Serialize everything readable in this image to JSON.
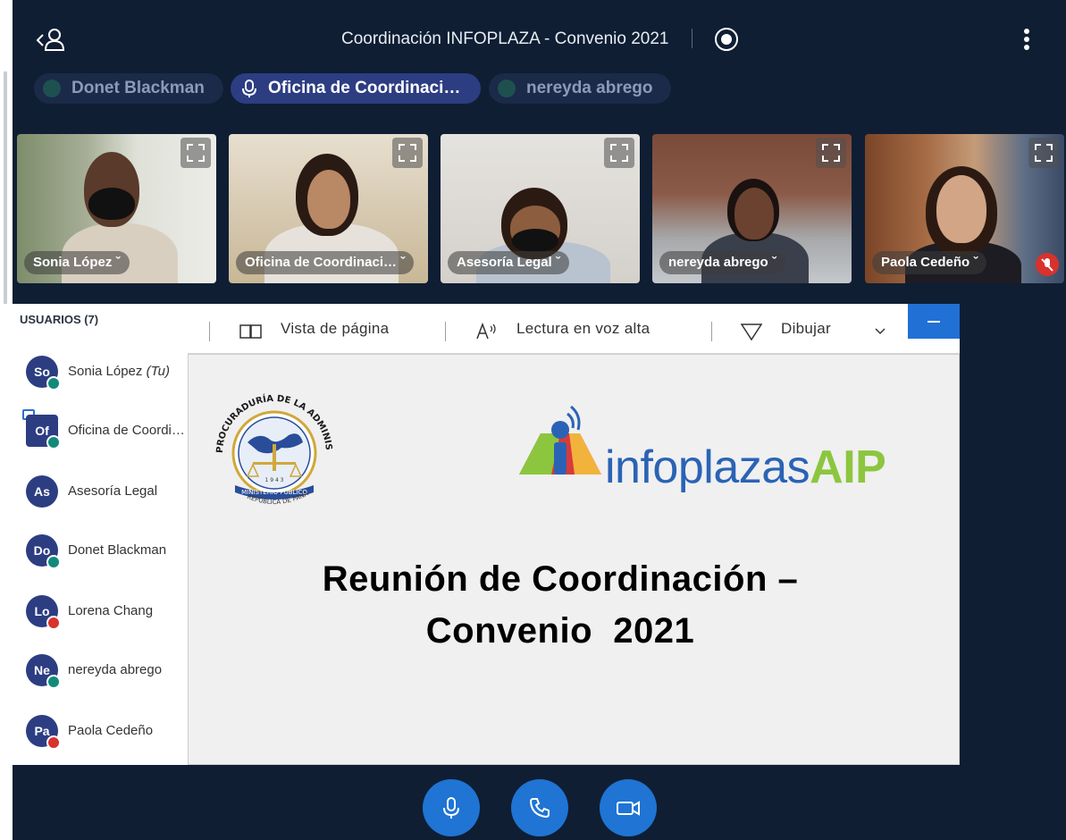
{
  "header": {
    "meeting_title": "Coordinación INFOPLAZA - Convenio 2021"
  },
  "speakers": [
    {
      "label": "Donet Blackman",
      "active": false
    },
    {
      "label": "Oficina de Coordinaci…",
      "active": true
    },
    {
      "label": "nereyda abrego",
      "active": false
    }
  ],
  "tiles": [
    {
      "label": "Sonia López ˇ"
    },
    {
      "label": "Oficina de Coordinaci… ˇ"
    },
    {
      "label": "Asesoría Legal ˇ"
    },
    {
      "label": "nereyda abrego ˇ"
    },
    {
      "label": "Paola Cedeño ˇ"
    }
  ],
  "users_panel": {
    "title": "USUARIOS (7)",
    "users": [
      {
        "initials": "So",
        "name": "Sonia López",
        "suffix": "(Tu)",
        "mic": "on"
      },
      {
        "initials": "Of",
        "name": "Oficina de Coordina…",
        "suffix": "",
        "mic": "on"
      },
      {
        "initials": "As",
        "name": "Asesoría Legal",
        "suffix": "",
        "mic": "off-none"
      },
      {
        "initials": "Do",
        "name": "Donet Blackman",
        "suffix": "",
        "mic": "on"
      },
      {
        "initials": "Lo",
        "name": "Lorena Chang",
        "suffix": "",
        "mic": "off"
      },
      {
        "initials": "Ne",
        "name": "nereyda abrego",
        "suffix": "",
        "mic": "on"
      },
      {
        "initials": "Pa",
        "name": "Paola Cedeño",
        "suffix": "",
        "mic": "off"
      }
    ]
  },
  "shared_screen": {
    "toolbar": {
      "page_view": "Vista de página",
      "read_aloud": "Lectura en voz alta",
      "draw": "Dibujar"
    },
    "slide": {
      "title_line1": "Reunión de Coordinación –",
      "title_line2": "Convenio  2021",
      "seal_arc_text": "PROCURADURÍA DE LA ADMINISTRACIÓN",
      "seal_year": "1 9 4 3",
      "seal_ribbon": "MINISTERIO PÚBLICO",
      "seal_bottom": "REPÚBLICA DE PANAMÁ",
      "brand_name": "infoplazas",
      "brand_suffix": "AIP"
    }
  },
  "colors": {
    "background": "#0f1e33",
    "accent": "#1f74d4",
    "active_pill": "#2c3d82",
    "muted": "#d8322d",
    "mic_on": "#128a7a"
  }
}
